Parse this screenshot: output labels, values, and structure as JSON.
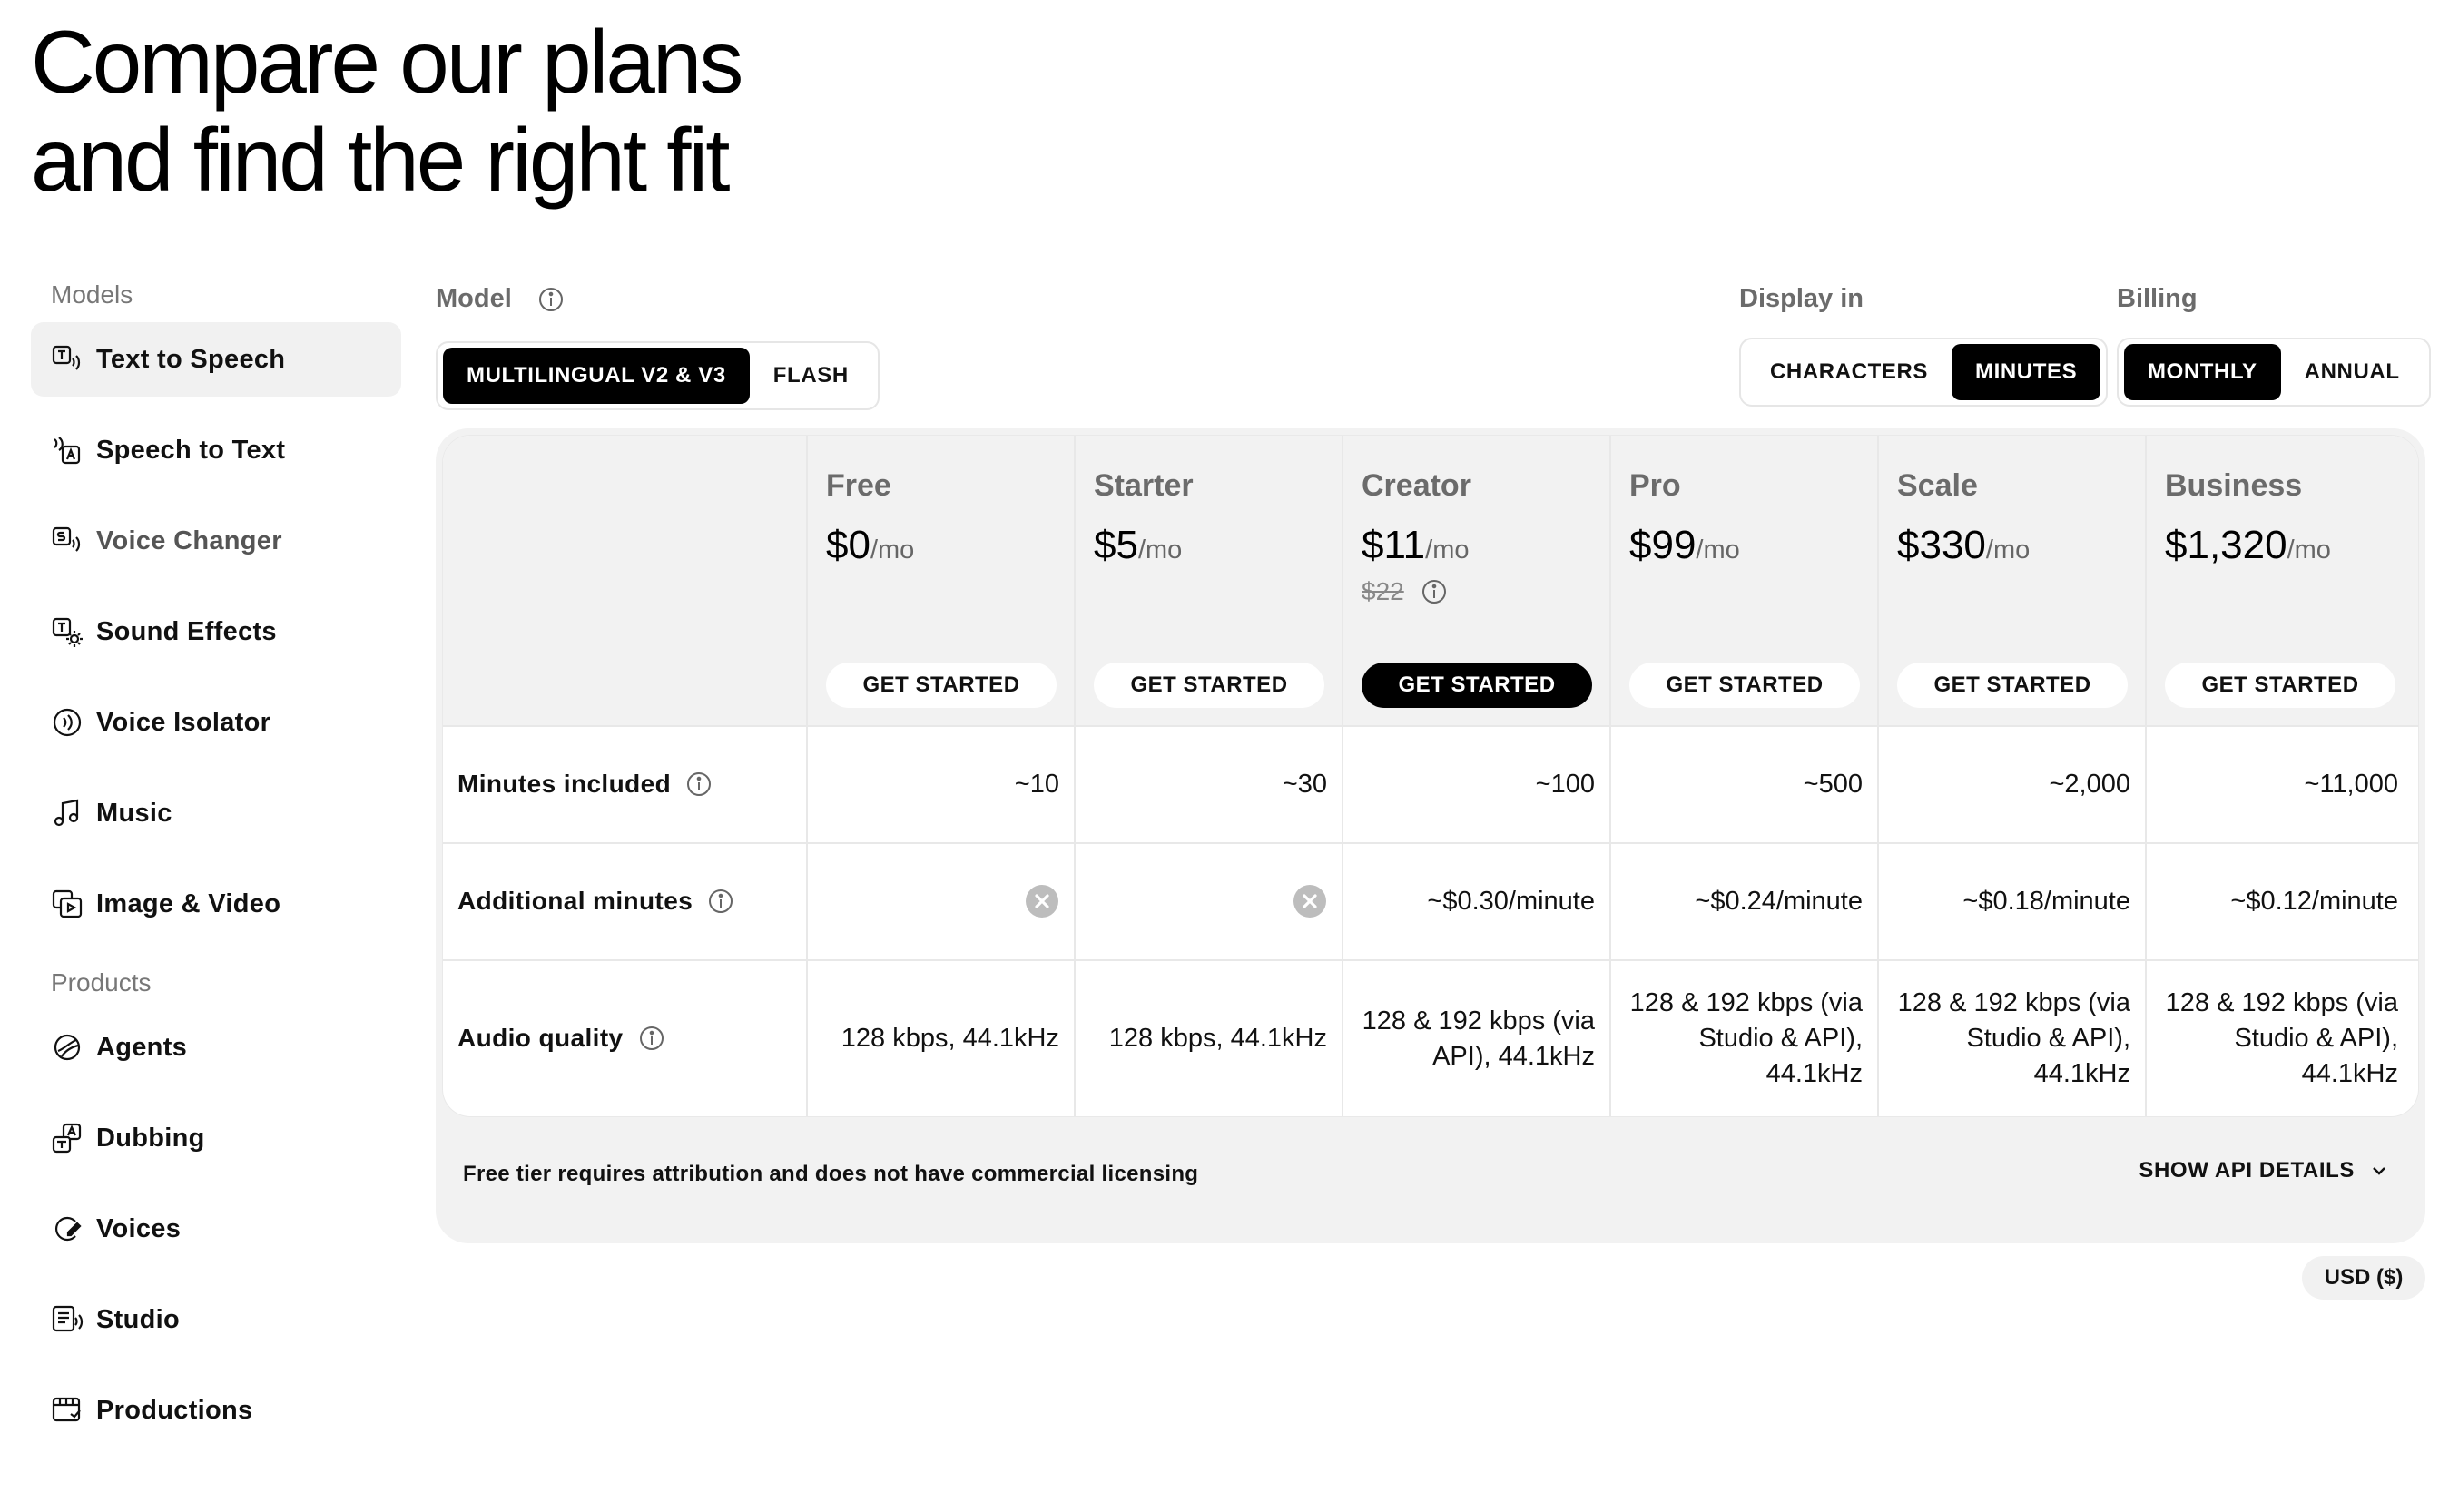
{
  "hero": {
    "line1": "Compare our plans",
    "line2": "and find the right fit"
  },
  "sidebar": {
    "models_heading": "Models",
    "models": [
      {
        "label": "Text to Speech",
        "icon": "text-to-speech-icon",
        "active": true
      },
      {
        "label": "Speech to Text",
        "icon": "speech-to-text-icon"
      },
      {
        "label": "Voice Changer",
        "icon": "voice-changer-icon"
      },
      {
        "label": "Sound Effects",
        "icon": "sound-effects-icon"
      },
      {
        "label": "Voice Isolator",
        "icon": "voice-isolator-icon"
      },
      {
        "label": "Music",
        "icon": "music-note-icon"
      },
      {
        "label": "Image & Video",
        "icon": "image-video-icon"
      }
    ],
    "products_heading": "Products",
    "products": [
      {
        "label": "Agents",
        "icon": "agents-icon"
      },
      {
        "label": "Dubbing",
        "icon": "dubbing-icon"
      },
      {
        "label": "Voices",
        "icon": "voices-icon"
      },
      {
        "label": "Studio",
        "icon": "studio-icon"
      },
      {
        "label": "Productions",
        "icon": "productions-icon"
      }
    ]
  },
  "controls": {
    "model_label": "Model",
    "model_options": [
      "MULTILINGUAL V2 & V3",
      "FLASH"
    ],
    "model_selected": "MULTILINGUAL V2 & V3",
    "display_label": "Display in",
    "display_options": [
      "CHARACTERS",
      "MINUTES"
    ],
    "display_selected": "MINUTES",
    "billing_label": "Billing",
    "billing_options": [
      "MONTHLY",
      "ANNUAL"
    ],
    "billing_selected": "MONTHLY"
  },
  "plans": [
    {
      "name": "Free",
      "price": "$0",
      "per": "/mo",
      "cta": "GET STARTED"
    },
    {
      "name": "Starter",
      "price": "$5",
      "per": "/mo",
      "cta": "GET STARTED"
    },
    {
      "name": "Creator",
      "price": "$11",
      "per": "/mo",
      "old_price": "$22",
      "cta": "GET STARTED",
      "highlight": true
    },
    {
      "name": "Pro",
      "price": "$99",
      "per": "/mo",
      "cta": "GET STARTED"
    },
    {
      "name": "Scale",
      "price": "$330",
      "per": "/mo",
      "cta": "GET STARTED"
    },
    {
      "name": "Business",
      "price": "$1,320",
      "per": "/mo",
      "cta": "GET STARTED"
    }
  ],
  "rows": {
    "minutes_included": {
      "label": "Minutes included",
      "values": [
        "~10",
        "~30",
        "~100",
        "~500",
        "~2,000",
        "~11,000"
      ]
    },
    "additional_minutes": {
      "label": "Additional minutes",
      "values": [
        "",
        "",
        "~$0.30/minute",
        "~$0.24/minute",
        "~$0.18/minute",
        "~$0.12/minute"
      ]
    },
    "audio_quality": {
      "label": "Audio quality",
      "values": [
        "128 kbps, 44.1kHz",
        "128 kbps, 44.1kHz",
        "128 & 192 kbps (via API), 44.1kHz",
        "128 & 192 kbps (via Studio & API), 44.1kHz",
        "128 & 192 kbps (via Studio & API), 44.1kHz",
        "128 & 192 kbps (via Studio & API), 44.1kHz"
      ]
    }
  },
  "footer": {
    "note": "Free tier requires attribution and does not have commercial licensing",
    "api_link": "SHOW API DETAILS",
    "currency": "USD ($)"
  }
}
